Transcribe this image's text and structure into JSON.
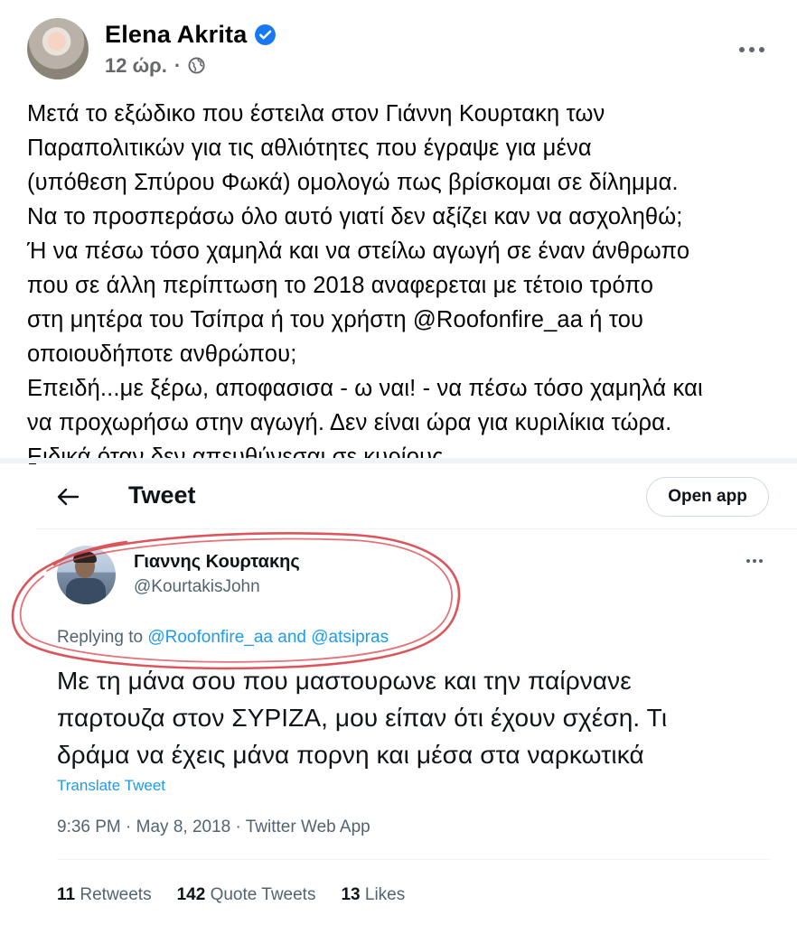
{
  "post": {
    "author": "Elena Akrita",
    "time": "12 ώρ.",
    "dot": "·",
    "paragraphs": [
      "Μετά το εξώδικο που έστειλα στον Γιάννη Κουρτακη των",
      "Παραπολιτικών για τις αθλιότητες που έγραψε για μένα",
      "(υπόθεση Σπύρου Φωκά) ομολογώ πως βρίσκομαι σε δίλημμα.",
      "Να το προσπεράσω όλο αυτό γιατί δεν αξίζει καν να ασχοληθώ;",
      "Ή να πέσω τόσο χαμηλά και να στείλω αγωγή σε έναν άνθρωπο",
      "που σε άλλη περίπτωση το 2018 αναφερεται με τέτοιο τρόπο",
      "στη μητέρα του Τσίπρα ή του χρήστη @Roofonfire_aa ή του",
      "οποιουδήποτε ανθρώπου;",
      "Επειδή...με ξέρω, αποφασισα - ω ναι! - να πέσω τόσο χαμηλά και",
      "να προχωρήσω στην αγωγή. Δεν είναι ώρα για κυριλίκια τώρα.",
      "Ειδικά όταν δεν απευθύνεσαι σε  κυρίους."
    ]
  },
  "tweet": {
    "header_title": "Tweet",
    "open_app_label": "Open app",
    "author_name": "Γιαννης Κουρτακης",
    "author_handle": "@KourtakisJohn",
    "replying_prefix": "Replying to ",
    "replying_user1": "@Roofonfire_aa",
    "replying_and": " and ",
    "replying_user2": "@atsipras",
    "body_lines": [
      "Με τη μάνα σου που μαστουρωνε και την παίρνανε",
      "παρτουζα στον ΣΥΡΙΖΑ, μου είπαν ότι έχουν σχέση. Τι",
      "δράμα να έχεις μάνα πορνη και μέσα στα ναρκωτικά"
    ],
    "translate_label": "Translate Tweet",
    "timestamp": "9:36 PM · May 8, 2018 · Twitter Web App",
    "stats": {
      "retweets_count": "11",
      "retweets_label": "Retweets",
      "quotes_count": "142",
      "quotes_label": "Quote Tweets",
      "likes_count": "13",
      "likes_label": "Likes"
    }
  },
  "colors": {
    "facebook_blue": "#1877f2",
    "twitter_blue": "#1d9bf0",
    "annotation_red": "#d9434a"
  },
  "icons": [
    "verified-badge-icon",
    "globe-icon",
    "more-options-icon",
    "back-arrow-icon"
  ]
}
